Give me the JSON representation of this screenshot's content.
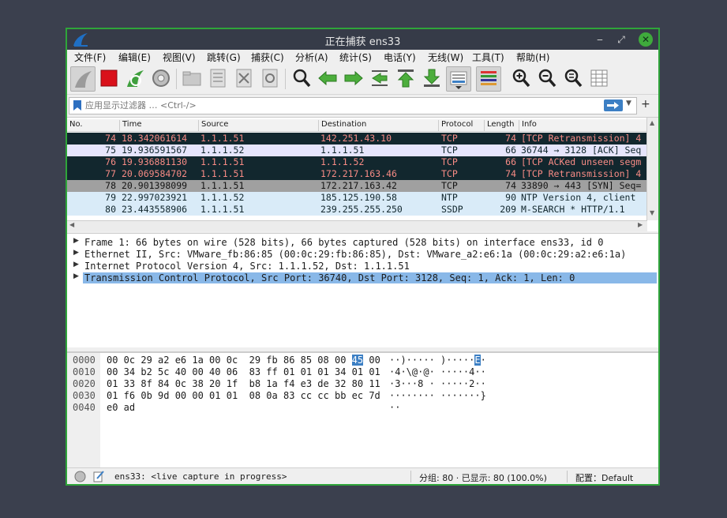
{
  "window": {
    "title": "正在捕获 ens33",
    "minimize": "‒",
    "maximize": "⤢",
    "close": "✕"
  },
  "menu": [
    "文件(F)",
    "编辑(E)",
    "视图(V)",
    "跳转(G)",
    "捕获(C)",
    "分析(A)",
    "统计(S)",
    "电话(Y)",
    "无线(W)",
    "工具(T)",
    "帮助(H)"
  ],
  "toolbar": {
    "icons": [
      "shark-fin-start-icon",
      "stop-capture-icon",
      "restart-capture-icon",
      "capture-options-icon",
      "open-file-icon",
      "save-file-icon",
      "close-file-icon",
      "reload-file-icon",
      "find-packet-icon",
      "go-back-icon",
      "go-forward-icon",
      "go-to-packet-icon",
      "go-first-icon",
      "go-last-icon",
      "autoscroll-icon",
      "colorize-icon",
      "zoom-in-icon",
      "zoom-out-icon",
      "zoom-reset-icon",
      "resize-columns-icon"
    ]
  },
  "filter": {
    "placeholder": "应用显示过滤器 … <Ctrl-/>",
    "add_label": "+"
  },
  "packet_list": {
    "columns": [
      "No.",
      "Time",
      "Source",
      "Destination",
      "Protocol",
      "Length",
      "Info"
    ],
    "rows": [
      {
        "no": "74",
        "time": "18.342061614",
        "src": "1.1.1.51",
        "dst": "142.251.43.10",
        "proto": "TCP",
        "len": "74",
        "info": "[TCP Retransmission] 4",
        "style": "black"
      },
      {
        "no": "75",
        "time": "19.936591567",
        "src": "1.1.1.52",
        "dst": "1.1.1.51",
        "proto": "TCP",
        "len": "66",
        "info": "36744 → 3128 [ACK] Seq",
        "style": "light"
      },
      {
        "no": "76",
        "time": "19.936881130",
        "src": "1.1.1.51",
        "dst": "1.1.1.52",
        "proto": "TCP",
        "len": "66",
        "info": "[TCP ACKed unseen segm",
        "style": "black"
      },
      {
        "no": "77",
        "time": "20.069584702",
        "src": "1.1.1.51",
        "dst": "172.217.163.46",
        "proto": "TCP",
        "len": "74",
        "info": "[TCP Retransmission] 4",
        "style": "black"
      },
      {
        "no": "78",
        "time": "20.901398099",
        "src": "1.1.1.51",
        "dst": "172.217.163.42",
        "proto": "TCP",
        "len": "74",
        "info": "33890 → 443 [SYN] Seq=",
        "style": "gray"
      },
      {
        "no": "79",
        "time": "22.997023921",
        "src": "1.1.1.52",
        "dst": "185.125.190.58",
        "proto": "NTP",
        "len": "90",
        "info": "NTP Version 4, client",
        "style": "blue"
      },
      {
        "no": "80",
        "time": "23.443558906",
        "src": "1.1.1.51",
        "dst": "239.255.255.250",
        "proto": "SSDP",
        "len": "209",
        "info": "M-SEARCH * HTTP/1.1",
        "style": "blue"
      }
    ]
  },
  "details": [
    {
      "arrow": "▶",
      "text": "Frame 1: 66 bytes on wire (528 bits), 66 bytes captured (528 bits) on interface ens33, id 0",
      "selected": false
    },
    {
      "arrow": "▶",
      "text": "Ethernet II, Src: VMware_fb:86:85 (00:0c:29:fb:86:85), Dst: VMware_a2:e6:1a (00:0c:29:a2:e6:1a)",
      "selected": false
    },
    {
      "arrow": "▶",
      "text": "Internet Protocol Version 4, Src: 1.1.1.52, Dst: 1.1.1.51",
      "selected": false
    },
    {
      "arrow": "▶",
      "text": "Transmission Control Protocol, Src Port: 36740, Dst Port: 3128, Seq: 1, Ack: 1, Len: 0",
      "selected": true
    }
  ],
  "bytes": [
    {
      "offset": "0000",
      "hex_a": "00 0c 29 a2 e6 1a 00 0c  29 fb 86 85 08 00 ",
      "hex_hl": "45",
      "hex_b": " 00",
      "ascii_a": "··)····· )·····",
      "ascii_hl": "E",
      "ascii_b": "·"
    },
    {
      "offset": "0010",
      "hex_a": "00 34 b2 5c 40 00 40 06  83 ff 01 01 01 34 01 01",
      "hex_hl": "",
      "hex_b": "",
      "ascii_a": "·4·\\@·@· ·····4··",
      "ascii_hl": "",
      "ascii_b": ""
    },
    {
      "offset": "0020",
      "hex_a": "01 33 8f 84 0c 38 20 1f  b8 1a f4 e3 de 32 80 11",
      "hex_hl": "",
      "hex_b": "",
      "ascii_a": "·3···8 · ·····2··",
      "ascii_hl": "",
      "ascii_b": ""
    },
    {
      "offset": "0030",
      "hex_a": "01 f6 0b 9d 00 00 01 01  08 0a 83 cc cc bb ec 7d",
      "hex_hl": "",
      "hex_b": "",
      "ascii_a": "········ ·······}",
      "ascii_hl": "",
      "ascii_b": ""
    },
    {
      "offset": "0040",
      "hex_a": "e0 ad",
      "hex_hl": "",
      "hex_b": "",
      "ascii_a": "··",
      "ascii_hl": "",
      "ascii_b": ""
    }
  ],
  "status": {
    "interface": "ens33: <live capture in progress>",
    "packets": "分组: 80 · 已显示: 80 (100.0%)",
    "profile": "配置：Default"
  },
  "colors": {
    "accent_green": "#2fa53a",
    "row_black": "#12272e",
    "row_black_text": "#f78b85",
    "selection_blue": "#89b8e8",
    "hex_highlight": "#3c7fc4"
  }
}
